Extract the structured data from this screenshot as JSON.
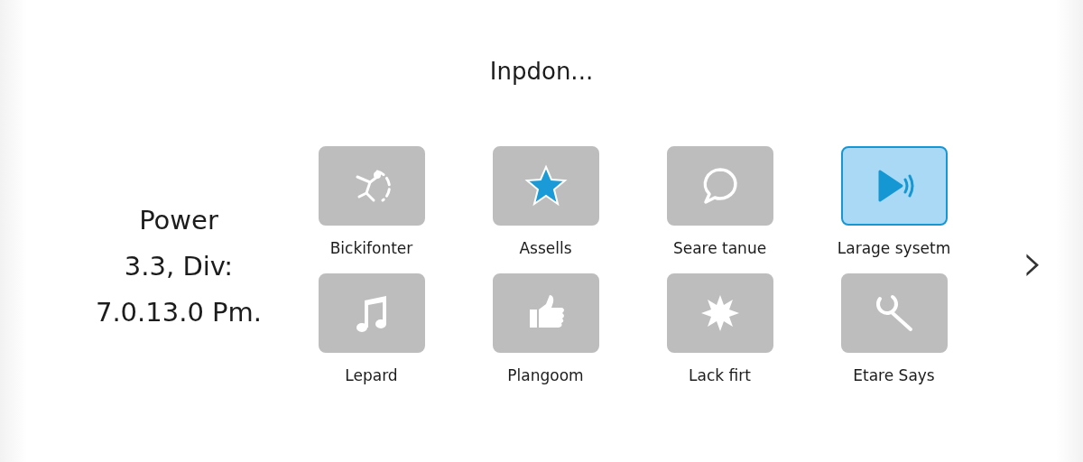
{
  "title": "Inpdon...",
  "info": [
    "Power",
    "3.3, Div:",
    "7.0.13.0 Pm."
  ],
  "apps": [
    {
      "label": "Bickifonter",
      "selected": false
    },
    {
      "label": "Assells",
      "selected": false
    },
    {
      "label": "Seare tanue",
      "selected": false
    },
    {
      "label": "Larage sysetm",
      "selected": true
    },
    {
      "label": "Lepard",
      "selected": false
    },
    {
      "label": "Plangoom",
      "selected": false
    },
    {
      "label": "Lack firt",
      "selected": false
    },
    {
      "label": "Etare Says",
      "selected": false
    }
  ],
  "next": {
    "glyph": "›"
  }
}
